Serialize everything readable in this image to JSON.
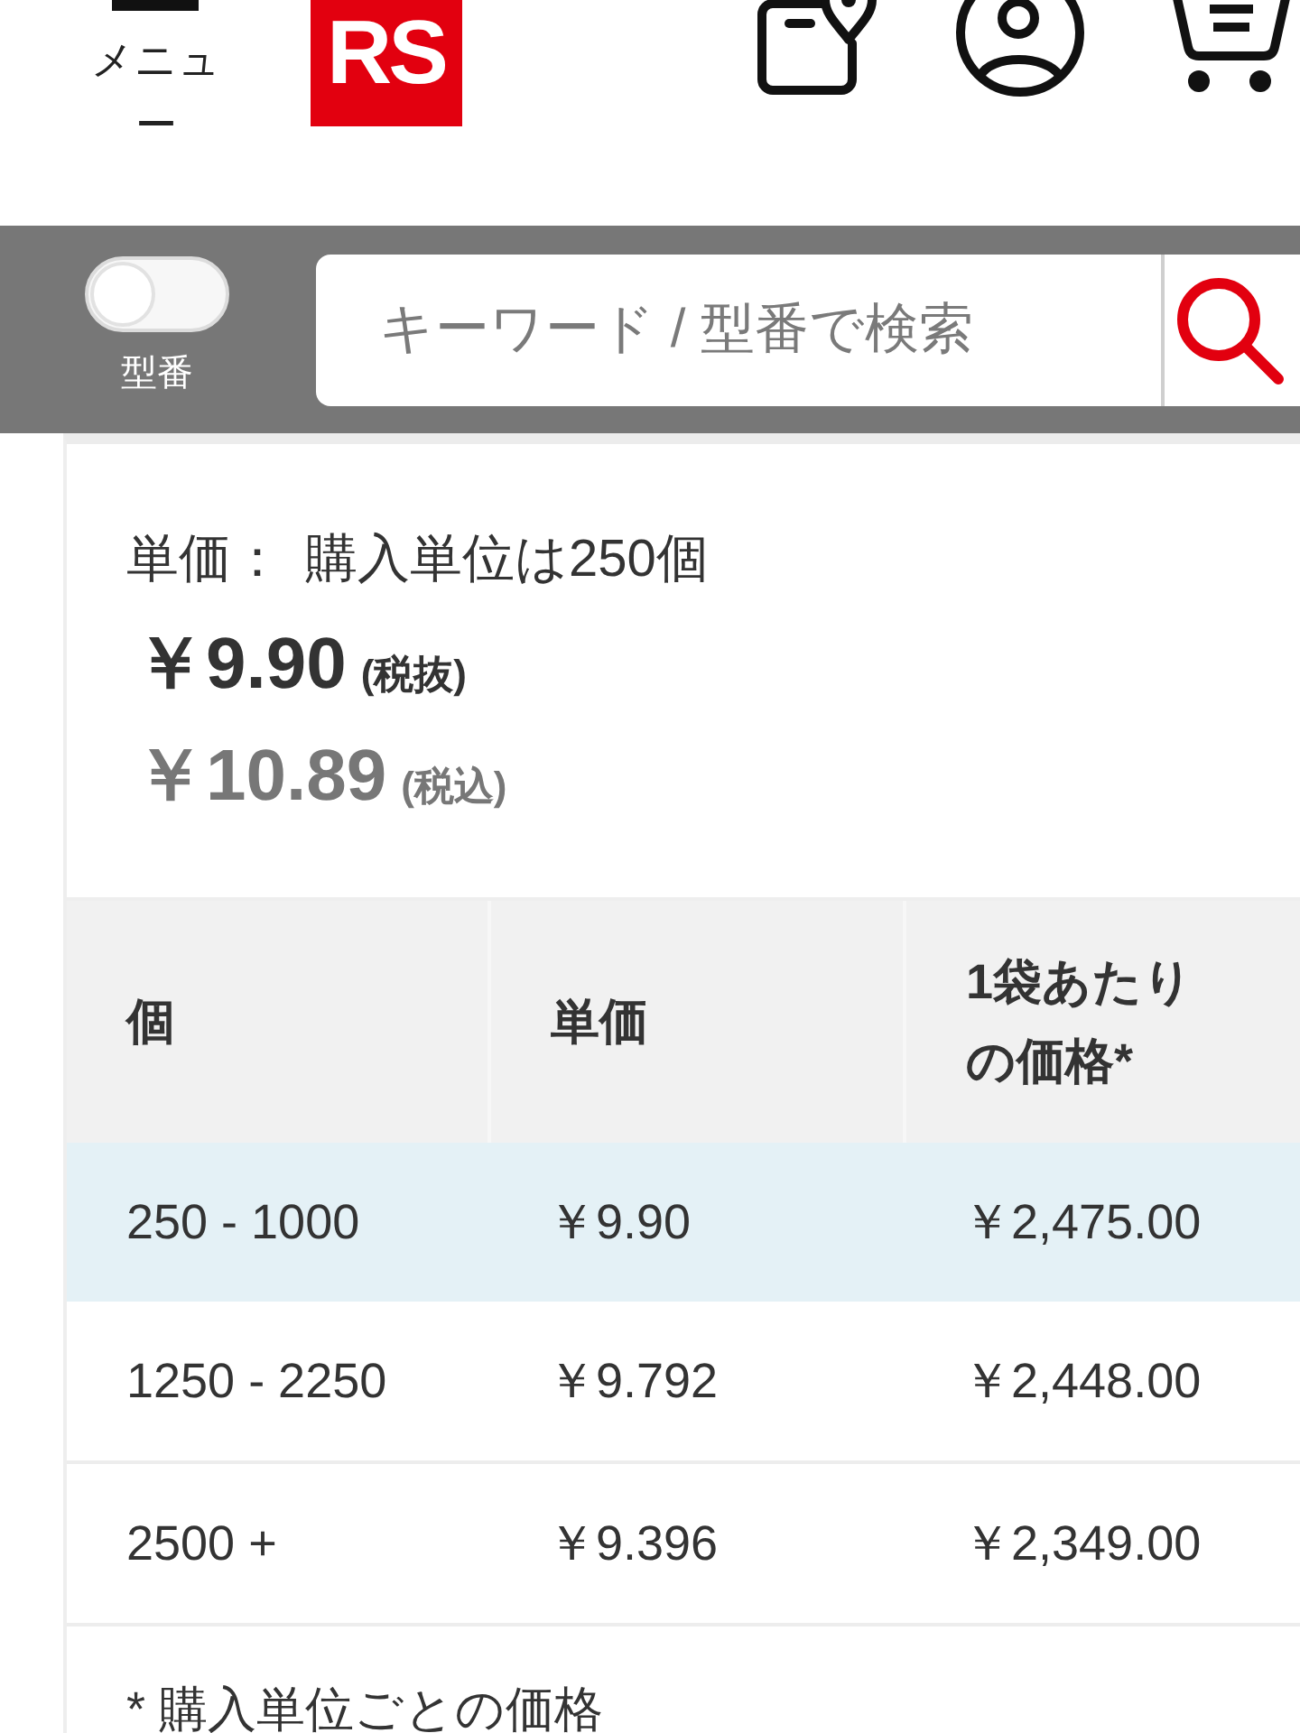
{
  "header": {
    "menu_label": "メニュー",
    "logo": "RS"
  },
  "search_bar": {
    "part_number_toggle": {
      "label": "型番",
      "on": false
    },
    "search": {
      "placeholder": "キーワード / 型番で検索"
    }
  },
  "price": {
    "unit": {
      "label": "単価：",
      "value": "購入単位は250個"
    },
    "excl_tax": {
      "amount": "￥9.90",
      "note": "(税抜)"
    },
    "incl_tax": {
      "amount": "￥10.89",
      "note": "(税込)"
    }
  },
  "price_table": {
    "columns": [
      "個",
      "単価",
      "1袋あたりの価格*"
    ],
    "rows": [
      {
        "cells": [
          "250 - 1000",
          "￥9.90",
          "￥2,475.00"
        ],
        "selected": true
      },
      {
        "cells": [
          "1250 - 2250",
          "￥9.792",
          "￥2,448.00"
        ],
        "selected": false
      },
      {
        "cells": [
          "2500 +",
          "￥9.396",
          "￥2,349.00"
        ],
        "selected": false
      }
    ],
    "footnote": "* 購入単位ごとの価格"
  }
}
